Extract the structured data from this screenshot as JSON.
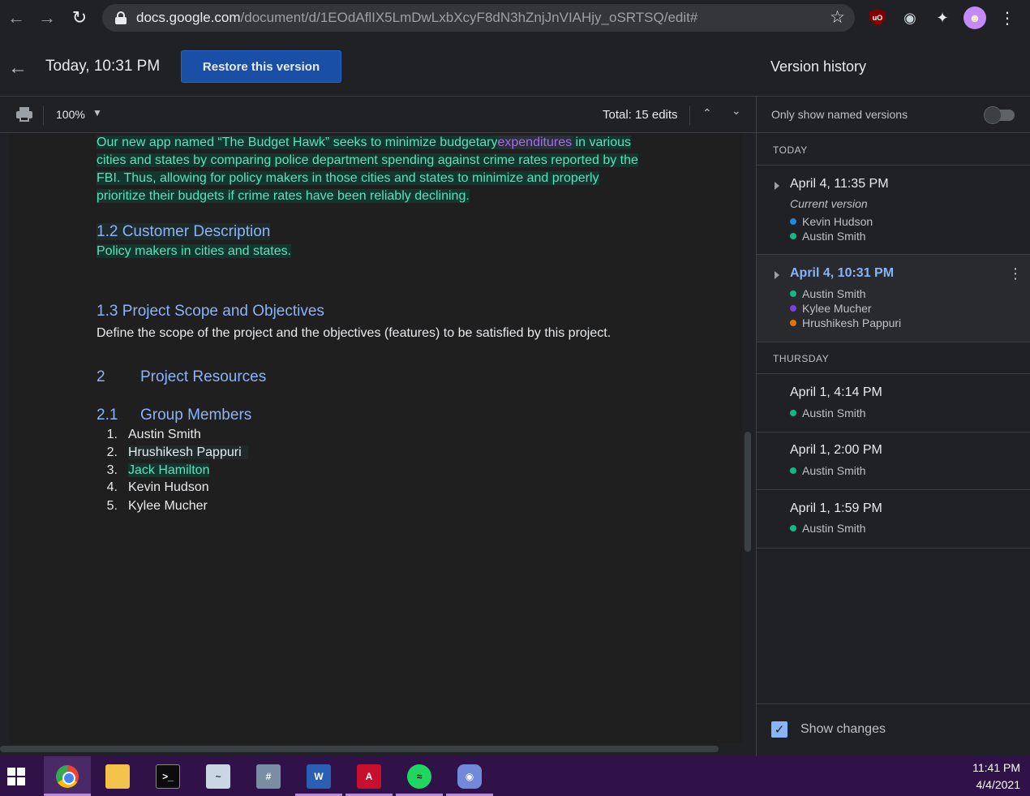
{
  "browser": {
    "url_host": "docs.google.com",
    "url_path": "/document/d/1EOdAflIX5LmDwLxbXcyF8dN3hZnjJnVIAHjy_oSRTSQ/edit#"
  },
  "header": {
    "version_time": "Today, 10:31 PM",
    "restore_label": "Restore this version",
    "panel_title": "Version history"
  },
  "toolbar": {
    "zoom": "100%",
    "total_edits": "Total: 15 edits"
  },
  "document": {
    "intro_lines": [
      "Our new app named  “The Budget Hawk” seeks to minimize budgetary",
      "expenditures",
      " in various",
      "cities and states by comparing police department spending against crime rates reported by the",
      "FBI. Thus, allowing for policy makers in those cities and states to minimize and properly",
      "prioritize their budgets if crime rates have been reliably declining."
    ],
    "customer_heading": "1.2 Customer Description",
    "customer_text": "Policy makers in cities and states.",
    "scope_heading": "1.3 Project Scope and Objectives",
    "scope_text": "Define the scope of the project and the objectives (features)  to be satisfied by this project.",
    "resources_num": "2",
    "resources_heading": "Project Resources",
    "members_num": "2.1",
    "members_heading": "Group Members",
    "members": [
      {
        "num": "1.",
        "name": "Austin Smith"
      },
      {
        "num": "2.",
        "name": "Hrushikesh Pappuri"
      },
      {
        "num": "3.",
        "name": "Jack Hamilton"
      },
      {
        "num": "4.",
        "name": "Kevin Hudson"
      },
      {
        "num": "5.",
        "name": "Kylee Mucher"
      }
    ]
  },
  "panel": {
    "only_named_label": "Only show named versions",
    "section_today": "TODAY",
    "section_thursday": "THURSDAY",
    "versions": [
      {
        "title": "April 4, 11:35 PM",
        "subtitle": "Current version",
        "users": [
          "Kevin Hudson",
          "Austin Smith"
        ]
      },
      {
        "title": "April 4, 10:31 PM",
        "users": [
          "Austin Smith",
          "Kylee Mucher",
          "Hrushikesh Pappuri"
        ]
      },
      {
        "title": "April 1, 4:14 PM",
        "users": [
          "Austin Smith"
        ]
      },
      {
        "title": "April 1, 2:00 PM",
        "users": [
          "Austin Smith"
        ]
      },
      {
        "title": "April 1, 1:59 PM",
        "users": [
          "Austin Smith"
        ]
      }
    ],
    "show_changes_label": "Show changes"
  },
  "user_colors": {
    "Kevin Hudson": "#1e88e5",
    "Austin Smith": "#12b886",
    "Kylee Mucher": "#7b3fe4",
    "Hrushikesh Pappuri": "#e8710a"
  },
  "taskbar": {
    "time": "11:41 PM",
    "date": "4/4/2021"
  }
}
